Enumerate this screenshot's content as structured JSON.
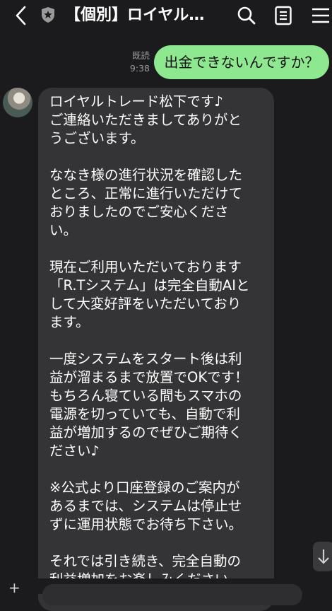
{
  "header": {
    "title": "【個別】ロイヤル…",
    "icons": [
      "back-chevron-icon",
      "shield-icon",
      "search-icon",
      "notes-icon",
      "menu-icon"
    ]
  },
  "messages": {
    "sent": {
      "read_status": "既読",
      "time": "9:38",
      "text": "出金できないんですか？"
    },
    "received": {
      "paragraphs": [
        "ロイヤルトレード松下です♪\nご連絡いただきましてありがと\nうございます。",
        "ななき様の進行状況を確認した\nところ、正常に進行いただけて\nおりましたのでご安心くださ\nい。",
        "現在ご利用いただいております\n「R.Tシステム」は完全自動AIと\nして大変好評をいただいており\nます。",
        "一度システムをスタート後は利\n益が溜まるまで放置でOKです！\nもちろん寝ている間もスマホの\n電源を切っていても、自動で利\n益が増加するのでぜひご期待く\nださい♪",
        "※公式より口座登録のご案内が\nあるまでは、システムは停止せ\nずに運用状態でお待ち下さい。",
        "それでは引き続き、完全自動の\n利益増加をお楽しみください\n(^^♪"
      ]
    }
  },
  "colors": {
    "background": "#1b1b1d",
    "sent_bubble": "#8de88f",
    "received_bubble": "#343436",
    "meta_text": "#9a9a9a"
  }
}
